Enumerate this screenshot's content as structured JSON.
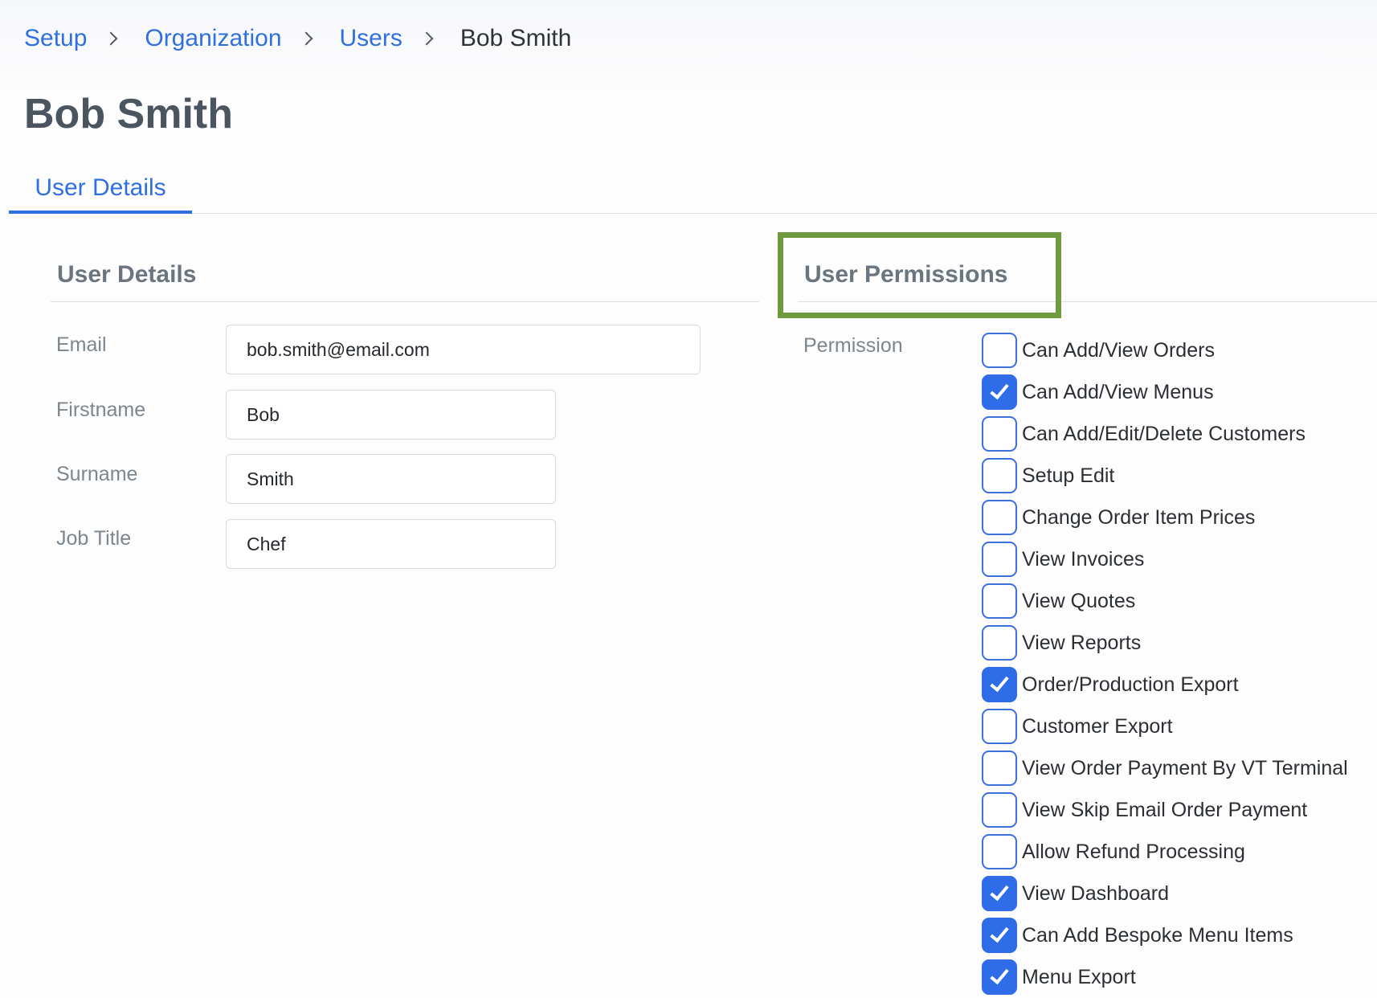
{
  "breadcrumb": {
    "items": [
      {
        "label": "Setup"
      },
      {
        "label": "Organization"
      },
      {
        "label": "Users"
      }
    ],
    "current": "Bob Smith"
  },
  "page": {
    "title": "Bob Smith"
  },
  "tabs": {
    "active": "User Details"
  },
  "details": {
    "title": "User Details",
    "fields": {
      "email": {
        "label": "Email",
        "value": "bob.smith@email.com"
      },
      "firstname": {
        "label": "Firstname",
        "value": "Bob"
      },
      "surname": {
        "label": "Surname",
        "value": "Smith"
      },
      "job_title": {
        "label": "Job Title",
        "value": "Chef"
      }
    }
  },
  "permissions": {
    "title": "User Permissions",
    "label": "Permission",
    "items": [
      {
        "label": "Can Add/View Orders",
        "checked": false
      },
      {
        "label": "Can Add/View Menus",
        "checked": true
      },
      {
        "label": "Can Add/Edit/Delete Customers",
        "checked": false
      },
      {
        "label": "Setup Edit",
        "checked": false
      },
      {
        "label": "Change Order Item Prices",
        "checked": false
      },
      {
        "label": "View Invoices",
        "checked": false
      },
      {
        "label": "View Quotes",
        "checked": false
      },
      {
        "label": "View Reports",
        "checked": false
      },
      {
        "label": "Order/Production Export",
        "checked": true
      },
      {
        "label": "Customer Export",
        "checked": false
      },
      {
        "label": "View Order Payment By VT Terminal",
        "checked": false
      },
      {
        "label": "View Skip Email Order Payment",
        "checked": false
      },
      {
        "label": "Allow Refund Processing",
        "checked": false
      },
      {
        "label": "View Dashboard",
        "checked": true
      },
      {
        "label": "Can Add Bespoke Menu Items",
        "checked": true
      },
      {
        "label": "Menu Export",
        "checked": true
      }
    ]
  },
  "colors": {
    "accent": "#2f6fe0",
    "highlight": "#6f9a3d",
    "checkbox_checked": "#2f6de8"
  }
}
